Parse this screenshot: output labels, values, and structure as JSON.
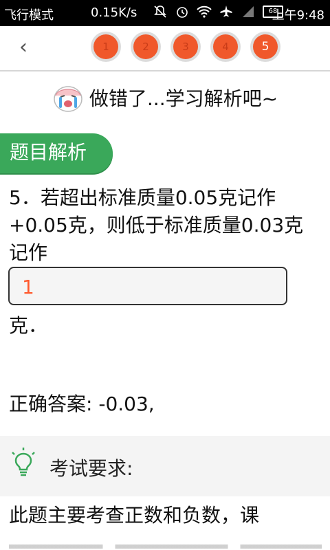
{
  "status_bar": {
    "airplane_mode": "飞行模式",
    "network_speed": "0.15K/s",
    "battery_level": "68",
    "time": "上午9:48",
    "icons": [
      "notifications-off-icon",
      "alarm-icon",
      "wifi-icon",
      "airplane-icon",
      "signal-icon",
      "battery-icon"
    ]
  },
  "nav": {
    "back_label": "‹",
    "questions": [
      "1",
      "2",
      "3",
      "4",
      "5"
    ],
    "current_question": "5",
    "accent_color": "#f0582b"
  },
  "result_heading": "做错了...学习解析吧~",
  "section_tab": "题目解析",
  "question": {
    "text": "5．若超出标准质量0.05克记作+0.05克，则低于标准质量0.03克记作",
    "user_answer": "1",
    "unit_suffix": "克．"
  },
  "correct_answer": "正确答案: -0.03,",
  "exam_requirement_label": "考试要求:",
  "explanation_start": "此题主要考查正数和负数，课",
  "colors": {
    "tab_green": "#3aa85a",
    "answer_orange": "#ff5a2e"
  }
}
